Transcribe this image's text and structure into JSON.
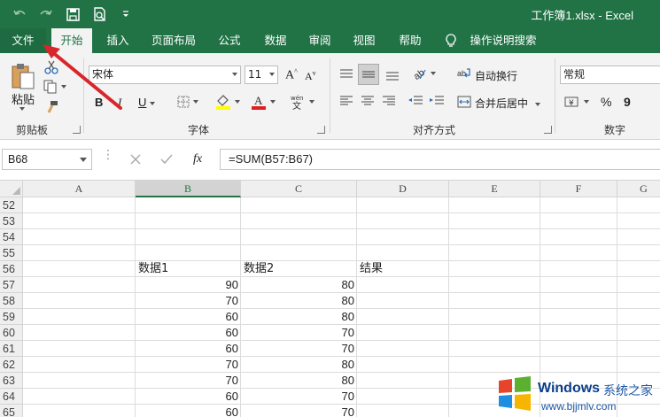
{
  "window": {
    "title": "工作簿1.xlsx  -  Excel"
  },
  "colors": {
    "accent": "#217346",
    "annotation_arrow": "#d9262a"
  },
  "tabs": [
    {
      "label": "文件",
      "active": false
    },
    {
      "label": "开始",
      "active": true
    },
    {
      "label": "插入",
      "active": false
    },
    {
      "label": "页面布局",
      "active": false
    },
    {
      "label": "公式",
      "active": false
    },
    {
      "label": "数据",
      "active": false
    },
    {
      "label": "审阅",
      "active": false
    },
    {
      "label": "视图",
      "active": false
    },
    {
      "label": "帮助",
      "active": false
    }
  ],
  "tell_me": "操作说明搜索",
  "ribbon": {
    "clipboard": {
      "paste_label": "粘贴",
      "group_label": "剪贴板"
    },
    "font": {
      "name": "宋体",
      "size": "11",
      "bold": "B",
      "italic": "I",
      "underline": "U",
      "grow": "A",
      "shrink": "A",
      "group_label": "字体"
    },
    "alignment": {
      "wrap_text": "自动换行",
      "merge_center": "合并后居中",
      "group_label": "对齐方式"
    },
    "number": {
      "format": "常规",
      "percent": "%",
      "comma": "9",
      "group_label": "数字"
    }
  },
  "formula_bar": {
    "name_box": "B68",
    "formula": "=SUM(B57:B67)",
    "fx": "fx"
  },
  "columns": [
    "A",
    "B",
    "C",
    "D",
    "E",
    "F",
    "G"
  ],
  "selected_column": "B",
  "rows": [
    {
      "num": "52",
      "b": "",
      "c": "",
      "d": ""
    },
    {
      "num": "53",
      "b": "",
      "c": "",
      "d": ""
    },
    {
      "num": "54",
      "b": "",
      "c": "",
      "d": ""
    },
    {
      "num": "55",
      "b": "",
      "c": "",
      "d": ""
    },
    {
      "num": "56",
      "b": "数据1",
      "c": "数据2",
      "d": "结果"
    },
    {
      "num": "57",
      "b": "90",
      "c": "80",
      "d": ""
    },
    {
      "num": "58",
      "b": "70",
      "c": "80",
      "d": ""
    },
    {
      "num": "59",
      "b": "60",
      "c": "80",
      "d": ""
    },
    {
      "num": "60",
      "b": "60",
      "c": "70",
      "d": ""
    },
    {
      "num": "61",
      "b": "60",
      "c": "70",
      "d": ""
    },
    {
      "num": "62",
      "b": "70",
      "c": "80",
      "d": ""
    },
    {
      "num": "63",
      "b": "70",
      "c": "80",
      "d": ""
    },
    {
      "num": "64",
      "b": "60",
      "c": "70",
      "d": ""
    },
    {
      "num": "65",
      "b": "60",
      "c": "70",
      "d": ""
    }
  ],
  "watermark": {
    "brand": "Windows",
    "cn": "系统之家",
    "url": "www.bjjmlv.com"
  }
}
